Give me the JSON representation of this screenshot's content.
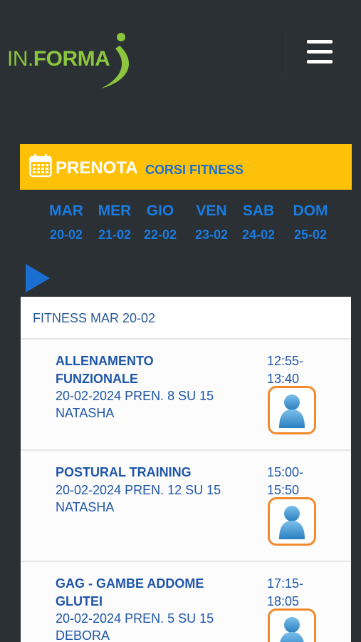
{
  "header": {
    "logo_prefix": "IN.",
    "logo_main": "FORMA",
    "menu_icon": "hamburger-menu-icon"
  },
  "banner": {
    "icon": "calendar-icon",
    "title": "PRENOTA",
    "subtitle": "CORSI FITNESS"
  },
  "days": [
    {
      "name": "MAR",
      "date": "20-02"
    },
    {
      "name": "MER",
      "date": "21-02"
    },
    {
      "name": "GIO",
      "date": "22-02"
    },
    {
      "name": "VEN",
      "date": "23-02"
    },
    {
      "name": "SAB",
      "date": "24-02"
    },
    {
      "name": "DOM",
      "date": "25-02"
    }
  ],
  "nav": {
    "next_icon": "play-arrow-icon"
  },
  "panel": {
    "heading": "FITNESS MAR 20-02",
    "classes": [
      {
        "name_line1": "ALLENAMENTO",
        "name_line2": "FUNZIONALE",
        "info": "20-02-2024 PREN. 8 SU 15",
        "instructor": "NATASHA",
        "time_start": "12:55-",
        "time_end": "13:40",
        "book_icon": "person-icon"
      },
      {
        "name_line1": "POSTURAL TRAINING",
        "name_line2": "",
        "info": "20-02-2024 PREN. 12 SU 15",
        "instructor": "NATASHA",
        "time_start": "15:00-",
        "time_end": "15:50",
        "book_icon": "person-icon"
      },
      {
        "name_line1": "GAG - GAMBE ADDOME",
        "name_line2": "GLUTEI",
        "info": "20-02-2024 PREN. 5 SU 15",
        "instructor": "DEBORA",
        "time_start": "17:15-",
        "time_end": "18:05",
        "book_icon": "person-icon"
      }
    ]
  },
  "colors": {
    "background": "#2a3033",
    "banner": "#ffc107",
    "accent_blue": "#1a7be0",
    "logo_green": "#8cc63f",
    "book_border": "#f08a2c"
  }
}
